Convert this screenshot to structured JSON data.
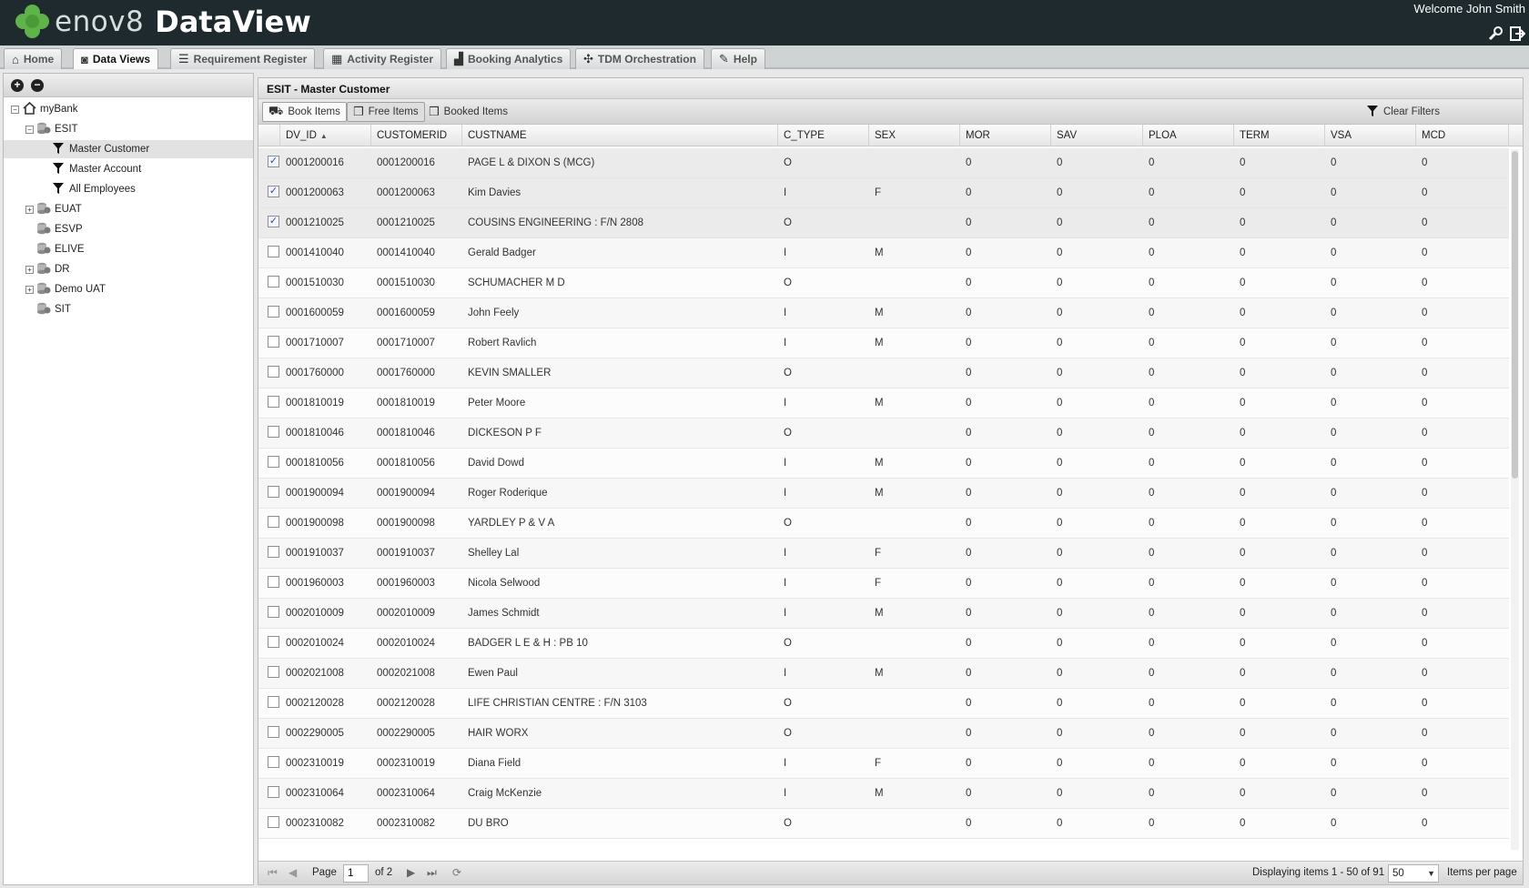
{
  "header": {
    "brand": "enov8",
    "product": "DataView",
    "welcome": "Welcome John Smith"
  },
  "tabs": [
    {
      "label": "Home",
      "icon": "home-icon",
      "active": false
    },
    {
      "label": "Data Views",
      "icon": "camera-icon",
      "active": true
    },
    {
      "label": "Requirement Register",
      "icon": "list-icon",
      "active": false
    },
    {
      "label": "Activity Register",
      "icon": "calendar-icon",
      "active": false
    },
    {
      "label": "Booking Analytics",
      "icon": "bar-chart-icon",
      "active": false
    },
    {
      "label": "TDM Orchestration",
      "icon": "network-icon",
      "active": false
    },
    {
      "label": "Help",
      "icon": "book-icon",
      "active": false
    }
  ],
  "tree": [
    {
      "label": "myBank",
      "level": 0,
      "expander": "−",
      "icon": "home-icon"
    },
    {
      "label": "ESIT",
      "level": 1,
      "expander": "−",
      "icon": "database-icon"
    },
    {
      "label": "Master Customer",
      "level": 2,
      "expander": "",
      "icon": "funnel-icon",
      "selected": true
    },
    {
      "label": "Master Account",
      "level": 2,
      "expander": "",
      "icon": "funnel-icon"
    },
    {
      "label": "All Employees",
      "level": 2,
      "expander": "",
      "icon": "funnel-icon"
    },
    {
      "label": "EUAT",
      "level": 1,
      "expander": "+",
      "icon": "database-icon"
    },
    {
      "label": "ESVP",
      "level": 1,
      "expander": "",
      "icon": "database-icon"
    },
    {
      "label": "ELIVE",
      "level": 1,
      "expander": "",
      "icon": "database-icon"
    },
    {
      "label": "DR",
      "level": 1,
      "expander": "+",
      "icon": "database-icon"
    },
    {
      "label": "Demo UAT",
      "level": 1,
      "expander": "+",
      "icon": "database-icon"
    },
    {
      "label": "SIT",
      "level": 1,
      "expander": "",
      "icon": "database-icon"
    }
  ],
  "panel": {
    "title": "ESIT - Master Customer",
    "toolbar": {
      "book_items": "Book Items",
      "free_items": "Free Items",
      "booked_items": "Booked Items",
      "clear_filters": "Clear Filters"
    }
  },
  "grid": {
    "columns": [
      "DV_ID",
      "CUSTOMERID",
      "CUSTNAME",
      "C_TYPE",
      "SEX",
      "MOR",
      "SAV",
      "PLOA",
      "TERM",
      "VSA",
      "MCD"
    ],
    "sort_column": "DV_ID",
    "rows": [
      {
        "checked": true,
        "cells": [
          "0001200016",
          "0001200016",
          "PAGE L & DIXON S (MCG)",
          "O",
          "",
          "0",
          "0",
          "0",
          "0",
          "0",
          "0"
        ]
      },
      {
        "checked": true,
        "cells": [
          "0001200063",
          "0001200063",
          "Kim Davies",
          "I",
          "F",
          "0",
          "0",
          "0",
          "0",
          "0",
          "0"
        ]
      },
      {
        "checked": true,
        "cells": [
          "0001210025",
          "0001210025",
          "COUSINS ENGINEERING : F/N 2808",
          "O",
          "",
          "0",
          "0",
          "0",
          "0",
          "0",
          "0"
        ]
      },
      {
        "checked": false,
        "cells": [
          "0001410040",
          "0001410040",
          "Gerald Badger",
          "I",
          "M",
          "0",
          "0",
          "0",
          "0",
          "0",
          "0"
        ]
      },
      {
        "checked": false,
        "cells": [
          "0001510030",
          "0001510030",
          "SCHUMACHER M D",
          "O",
          "",
          "0",
          "0",
          "0",
          "0",
          "0",
          "0"
        ]
      },
      {
        "checked": false,
        "cells": [
          "0001600059",
          "0001600059",
          "John Feely",
          "I",
          "M",
          "0",
          "0",
          "0",
          "0",
          "0",
          "0"
        ]
      },
      {
        "checked": false,
        "cells": [
          "0001710007",
          "0001710007",
          "Robert Ravlich",
          "I",
          "M",
          "0",
          "0",
          "0",
          "0",
          "0",
          "0"
        ]
      },
      {
        "checked": false,
        "cells": [
          "0001760000",
          "0001760000",
          "KEVIN SMALLER",
          "O",
          "",
          "0",
          "0",
          "0",
          "0",
          "0",
          "0"
        ]
      },
      {
        "checked": false,
        "cells": [
          "0001810019",
          "0001810019",
          "Peter Moore",
          "I",
          "M",
          "0",
          "0",
          "0",
          "0",
          "0",
          "0"
        ]
      },
      {
        "checked": false,
        "cells": [
          "0001810046",
          "0001810046",
          "DICKESON P F",
          "O",
          "",
          "0",
          "0",
          "0",
          "0",
          "0",
          "0"
        ]
      },
      {
        "checked": false,
        "cells": [
          "0001810056",
          "0001810056",
          "David Dowd",
          "I",
          "M",
          "0",
          "0",
          "0",
          "0",
          "0",
          "0"
        ]
      },
      {
        "checked": false,
        "cells": [
          "0001900094",
          "0001900094",
          "Roger Roderique",
          "I",
          "M",
          "0",
          "0",
          "0",
          "0",
          "0",
          "0"
        ]
      },
      {
        "checked": false,
        "cells": [
          "0001900098",
          "0001900098",
          "YARDLEY P & V A",
          "O",
          "",
          "0",
          "0",
          "0",
          "0",
          "0",
          "0"
        ]
      },
      {
        "checked": false,
        "cells": [
          "0001910037",
          "0001910037",
          "Shelley Lal",
          "I",
          "F",
          "0",
          "0",
          "0",
          "0",
          "0",
          "0"
        ]
      },
      {
        "checked": false,
        "cells": [
          "0001960003",
          "0001960003",
          "Nicola Selwood",
          "I",
          "F",
          "0",
          "0",
          "0",
          "0",
          "0",
          "0"
        ]
      },
      {
        "checked": false,
        "cells": [
          "0002010009",
          "0002010009",
          "James Schmidt",
          "I",
          "M",
          "0",
          "0",
          "0",
          "0",
          "0",
          "0"
        ]
      },
      {
        "checked": false,
        "cells": [
          "0002010024",
          "0002010024",
          "BADGER L E & H : PB 10",
          "O",
          "",
          "0",
          "0",
          "0",
          "0",
          "0",
          "0"
        ]
      },
      {
        "checked": false,
        "cells": [
          "0002021008",
          "0002021008",
          "Ewen Paul",
          "I",
          "M",
          "0",
          "0",
          "0",
          "0",
          "0",
          "0"
        ]
      },
      {
        "checked": false,
        "cells": [
          "0002120028",
          "0002120028",
          "LIFE CHRISTIAN CENTRE : F/N 3103",
          "O",
          "",
          "0",
          "0",
          "0",
          "0",
          "0",
          "0"
        ]
      },
      {
        "checked": false,
        "cells": [
          "0002290005",
          "0002290005",
          "HAIR WORX",
          "O",
          "",
          "0",
          "0",
          "0",
          "0",
          "0",
          "0"
        ]
      },
      {
        "checked": false,
        "cells": [
          "0002310019",
          "0002310019",
          "Diana Field",
          "I",
          "F",
          "0",
          "0",
          "0",
          "0",
          "0",
          "0"
        ]
      },
      {
        "checked": false,
        "cells": [
          "0002310064",
          "0002310064",
          "Craig McKenzie",
          "I",
          "M",
          "0",
          "0",
          "0",
          "0",
          "0",
          "0"
        ]
      },
      {
        "checked": false,
        "cells": [
          "0002310082",
          "0002310082",
          "DU BRO",
          "O",
          "",
          "0",
          "0",
          "0",
          "0",
          "0",
          "0"
        ]
      }
    ]
  },
  "pager": {
    "page_label": "Page",
    "page_value": "1",
    "of_label": "of 2",
    "display_text": "Displaying items 1 - 50 of 91",
    "per_page_value": "50",
    "per_page_label": "Items per page"
  },
  "colors": {
    "header_bg": "#1f2a2f",
    "brand_green": "#5fb34a"
  }
}
